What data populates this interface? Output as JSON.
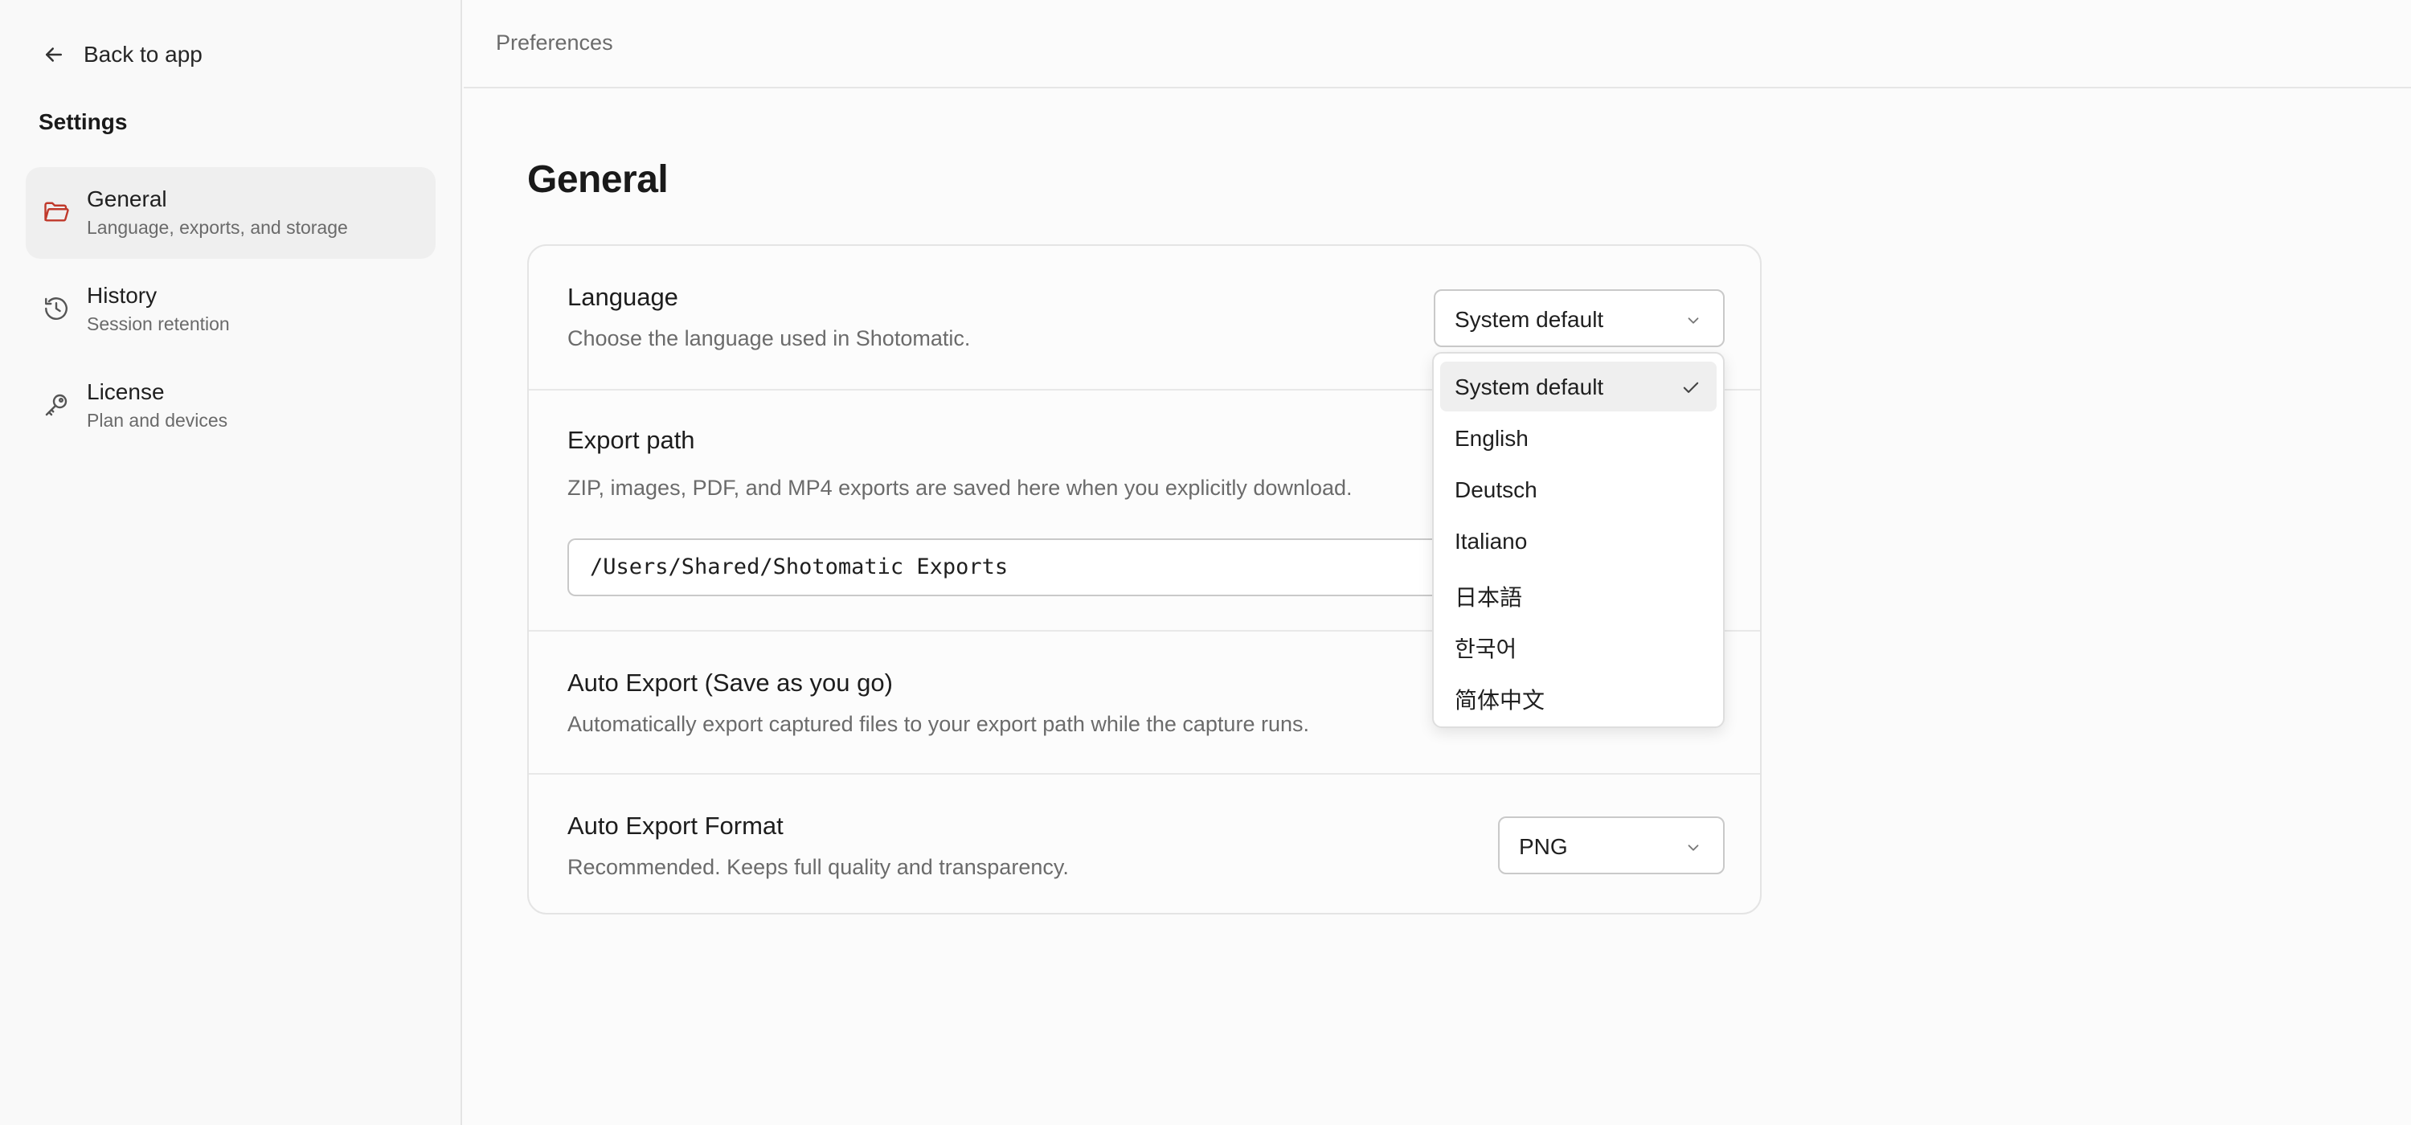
{
  "sidebar": {
    "back_label": "Back to app",
    "section_title": "Settings",
    "items": [
      {
        "label": "General",
        "desc": "Language, exports, and storage",
        "icon": "folder-icon",
        "active": true
      },
      {
        "label": "History",
        "desc": "Session retention",
        "icon": "history-icon",
        "active": false
      },
      {
        "label": "License",
        "desc": "Plan and devices",
        "icon": "key-icon",
        "active": false
      }
    ]
  },
  "header": {
    "breadcrumb": "Preferences"
  },
  "main": {
    "title": "General",
    "language": {
      "title": "Language",
      "desc": "Choose the language used in Shotomatic.",
      "selected": "System default",
      "options": [
        "System default",
        "English",
        "Deutsch",
        "Italiano",
        "日本語",
        "한국어",
        "简体中文"
      ]
    },
    "export_path": {
      "title": "Export path",
      "desc": "ZIP, images, PDF, and MP4 exports are saved here when you explicitly download.",
      "value": "/Users/Shared/Shotomatic Exports"
    },
    "auto_export": {
      "title": "Auto Export (Save as you go)",
      "desc": "Automatically export captured files to your export path while the capture runs."
    },
    "auto_export_format": {
      "title": "Auto Export Format",
      "desc": "Recommended. Keeps full quality and transparency.",
      "selected": "PNG"
    }
  },
  "colors": {
    "active_icon": "#c0392b",
    "accent_bg": "#efefef"
  }
}
